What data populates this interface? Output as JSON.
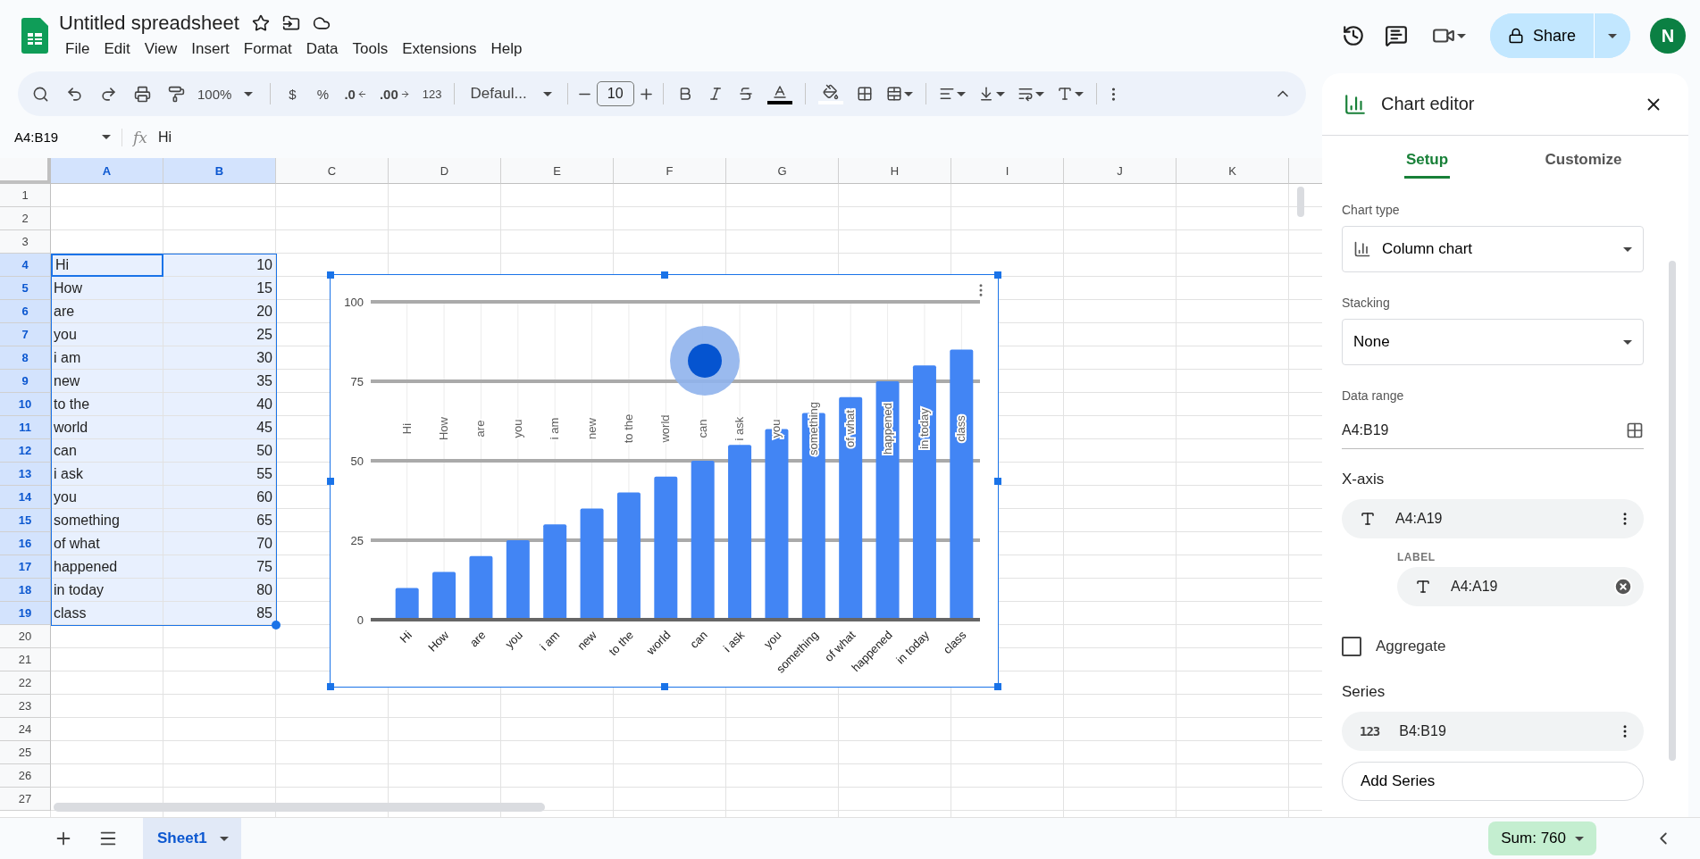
{
  "document": {
    "title": "Untitled spreadsheet",
    "menu": [
      "File",
      "Edit",
      "View",
      "Insert",
      "Format",
      "Data",
      "Tools",
      "Extensions",
      "Help"
    ]
  },
  "header_actions": {
    "share": "Share",
    "avatar": "N"
  },
  "toolbar": {
    "zoom": "100%",
    "currency": "$",
    "percent": "%",
    "decrease_decimal": ".0",
    "increase_decimal": ".00",
    "number_format": "123",
    "font": "Defaul...",
    "font_size": "10"
  },
  "formula_bar": {
    "name_box": "A4:B19",
    "fx": "fx",
    "value": "Hi"
  },
  "sheet": {
    "columns": [
      {
        "label": "A",
        "selected": true
      },
      {
        "label": "B",
        "selected": true
      },
      {
        "label": "C",
        "selected": false
      },
      {
        "label": "D",
        "selected": false
      },
      {
        "label": "E",
        "selected": false
      },
      {
        "label": "F",
        "selected": false
      },
      {
        "label": "G",
        "selected": false
      },
      {
        "label": "H",
        "selected": false
      },
      {
        "label": "I",
        "selected": false
      },
      {
        "label": "J",
        "selected": false
      },
      {
        "label": "K",
        "selected": false
      }
    ],
    "rows": [
      {
        "number": "1",
        "selected": false
      },
      {
        "number": "2",
        "selected": false
      },
      {
        "number": "3",
        "selected": false
      },
      {
        "number": "4",
        "selected": true,
        "cells": [
          {
            "text": "Hi",
            "active": true
          },
          {
            "text": "10",
            "active": false
          }
        ]
      },
      {
        "number": "5",
        "selected": true,
        "cells": [
          {
            "text": "How",
            "active": false
          },
          {
            "text": "15",
            "active": false
          }
        ]
      },
      {
        "number": "6",
        "selected": true,
        "cells": [
          {
            "text": "are",
            "active": false
          },
          {
            "text": "20",
            "active": false
          }
        ]
      },
      {
        "number": "7",
        "selected": true,
        "cells": [
          {
            "text": "you",
            "active": false
          },
          {
            "text": "25",
            "active": false
          }
        ]
      },
      {
        "number": "8",
        "selected": true,
        "cells": [
          {
            "text": "i am",
            "active": false
          },
          {
            "text": "30",
            "active": false
          }
        ]
      },
      {
        "number": "9",
        "selected": true,
        "cells": [
          {
            "text": "new",
            "active": false
          },
          {
            "text": "35",
            "active": false
          }
        ]
      },
      {
        "number": "10",
        "selected": true,
        "cells": [
          {
            "text": "to the",
            "active": false
          },
          {
            "text": "40",
            "active": false
          }
        ]
      },
      {
        "number": "11",
        "selected": true,
        "cells": [
          {
            "text": "world",
            "active": false
          },
          {
            "text": "45",
            "active": false
          }
        ]
      },
      {
        "number": "12",
        "selected": true,
        "cells": [
          {
            "text": "can",
            "active": false
          },
          {
            "text": "50",
            "active": false
          }
        ]
      },
      {
        "number": "13",
        "selected": true,
        "cells": [
          {
            "text": "i ask",
            "active": false
          },
          {
            "text": "55",
            "active": false
          }
        ]
      },
      {
        "number": "14",
        "selected": true,
        "cells": [
          {
            "text": "you",
            "active": false
          },
          {
            "text": "60",
            "active": false
          }
        ]
      },
      {
        "number": "15",
        "selected": true,
        "cells": [
          {
            "text": "something",
            "active": false
          },
          {
            "text": "65",
            "active": false
          }
        ]
      },
      {
        "number": "16",
        "selected": true,
        "cells": [
          {
            "text": "of what",
            "active": false
          },
          {
            "text": "70",
            "active": false
          }
        ]
      },
      {
        "number": "17",
        "selected": true,
        "cells": [
          {
            "text": "happened",
            "active": false
          },
          {
            "text": "75",
            "active": false
          }
        ]
      },
      {
        "number": "18",
        "selected": true,
        "cells": [
          {
            "text": "in today",
            "active": false
          },
          {
            "text": "80",
            "active": false
          }
        ]
      },
      {
        "number": "19",
        "selected": true,
        "cells": [
          {
            "text": "class",
            "active": false
          },
          {
            "text": "85",
            "active": false
          }
        ]
      },
      {
        "number": "20",
        "selected": false
      },
      {
        "number": "21",
        "selected": false
      },
      {
        "number": "22",
        "selected": false
      },
      {
        "number": "23",
        "selected": false
      },
      {
        "number": "24",
        "selected": false
      },
      {
        "number": "25",
        "selected": false
      },
      {
        "number": "26",
        "selected": false
      },
      {
        "number": "27",
        "selected": false
      }
    ]
  },
  "chart": {
    "chart_data": {
      "type": "bar",
      "categories": [
        "Hi",
        "How",
        "are",
        "you",
        "i am",
        "new",
        "to the",
        "world",
        "can",
        "i ask",
        "you",
        "something",
        "of what",
        "happened",
        "in today",
        "class"
      ],
      "values": [
        10,
        15,
        20,
        25,
        30,
        35,
        40,
        45,
        50,
        55,
        60,
        65,
        70,
        75,
        80,
        85
      ],
      "ylim": [
        0,
        100
      ],
      "yticks": [
        0,
        25,
        50,
        75,
        100
      ],
      "grid": true
    },
    "overlay_labels": [
      "Hi",
      "How",
      "are",
      "you",
      "i am",
      "new",
      "to the",
      "world",
      "can",
      "i ask",
      "you",
      "something",
      "of what",
      "happened",
      "in today",
      "class"
    ]
  },
  "sheet_tabs": [
    {
      "label": "Sheet1",
      "selected": true
    }
  ],
  "status": {
    "sum": "Sum: 760"
  },
  "chart_editor": {
    "title": "Chart editor",
    "tabs": [
      {
        "label": "Setup",
        "selected": true
      },
      {
        "label": "Customize",
        "selected": false
      }
    ],
    "chart_type": {
      "label": "Chart type",
      "value": "Column chart"
    },
    "stacking": {
      "label": "Stacking",
      "value": "None"
    },
    "data_range": {
      "label": "Data range",
      "value": "A4:B19"
    },
    "x_axis": {
      "heading": "X-axis",
      "range": "A4:A19",
      "label_caption": "LABEL",
      "label_range": "A4:A19"
    },
    "aggregate": {
      "label": "Aggregate",
      "checked": false
    },
    "series": {
      "heading": "Series",
      "icon_text": "123",
      "range": "B4:B19"
    },
    "add_series": "Add Series"
  }
}
